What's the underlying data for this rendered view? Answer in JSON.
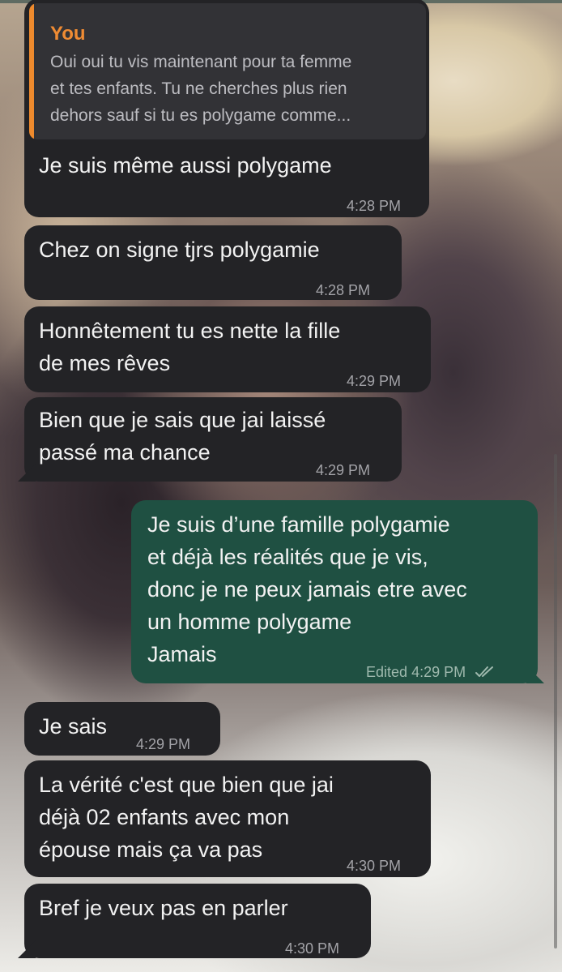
{
  "reply": {
    "author": "You",
    "text": "Oui oui tu vis maintenant pour ta femme\net tes enfants. Tu ne cherches plus rien\ndehors sauf si tu es polygame comme..."
  },
  "messages": [
    {
      "text": "Je suis même aussi polygame",
      "time": "4:28 PM"
    },
    {
      "text": "Chez on signe tjrs polygamie",
      "time": "4:28 PM"
    },
    {
      "text": "Honnêtement tu es nette la fille\nde mes rêves",
      "time": "4:29 PM"
    },
    {
      "text": "Bien que je sais que jai laissé\npassé ma chance",
      "time": "4:29 PM"
    },
    {
      "text": "Je suis d’une famille polygamie\net déjà les réalités que je vis,\ndonc je ne peux jamais etre avec\nun homme polygame\nJamais",
      "status": "Edited",
      "time": "4:29 PM",
      "read_icon": "double-check-icon"
    },
    {
      "text": "Je sais",
      "time": "4:29 PM"
    },
    {
      "text": "La vérité c'est que bien que jai\ndéjà 02 enfants avec mon\népouse mais ça va pas",
      "time": "4:30 PM"
    },
    {
      "text": "Bref je veux pas en parler",
      "time": "4:30 PM"
    }
  ],
  "colors": {
    "incoming_bubble": "#232326",
    "outgoing_bubble": "#1f5042",
    "reply_accent": "#ef8b33"
  }
}
